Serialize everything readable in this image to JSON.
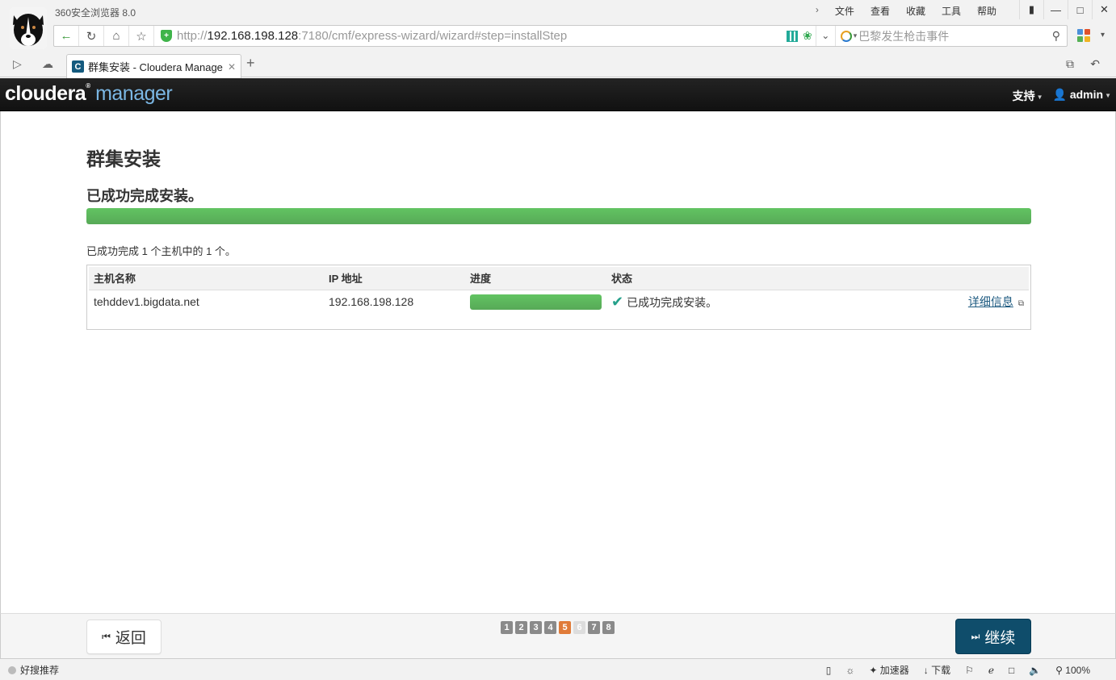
{
  "browser": {
    "app_title": "360安全浏览器 8.0",
    "menu": [
      "文件",
      "查看",
      "收藏",
      "工具",
      "帮助"
    ],
    "url_scheme": "http://",
    "url_host": "192.168.198.128",
    "url_rest": ":7180/cmf/express-wizard/wizard#step=installStep",
    "search_placeholder": "巴黎发生枪击事件",
    "tab_title": "群集安装 - Cloudera Manage",
    "status_left": "好搜推荐",
    "status_accelerator": "加速器",
    "status_download": "下载",
    "zoom": "100%"
  },
  "header": {
    "logo_main": "cloudera",
    "logo_sub": "manager",
    "support": "支持",
    "user": "admin"
  },
  "main": {
    "page_title": "群集安装",
    "status_title": "已成功完成安装。",
    "overall_progress": 100,
    "summary": "已成功完成 1 个主机中的 1 个。",
    "table": {
      "columns": [
        "主机名称",
        "IP 地址",
        "进度",
        "状态"
      ],
      "rows": [
        {
          "host": "tehddev1.bigdata.net",
          "ip": "192.168.198.128",
          "progress": 100,
          "status": "已成功完成安装。",
          "details": "详细信息"
        }
      ]
    }
  },
  "footer": {
    "back_label": "返回",
    "continue_label": "继续",
    "steps": [
      "1",
      "2",
      "3",
      "4",
      "5",
      "6",
      "7",
      "8"
    ],
    "current_step": "5"
  },
  "colors": {
    "progress_green": "#5cb85c",
    "continue_blue": "#0f4d6b",
    "step_current": "#e07b39",
    "header_bg": "#1a1a1a",
    "logo_blue": "#7bb7e4"
  }
}
